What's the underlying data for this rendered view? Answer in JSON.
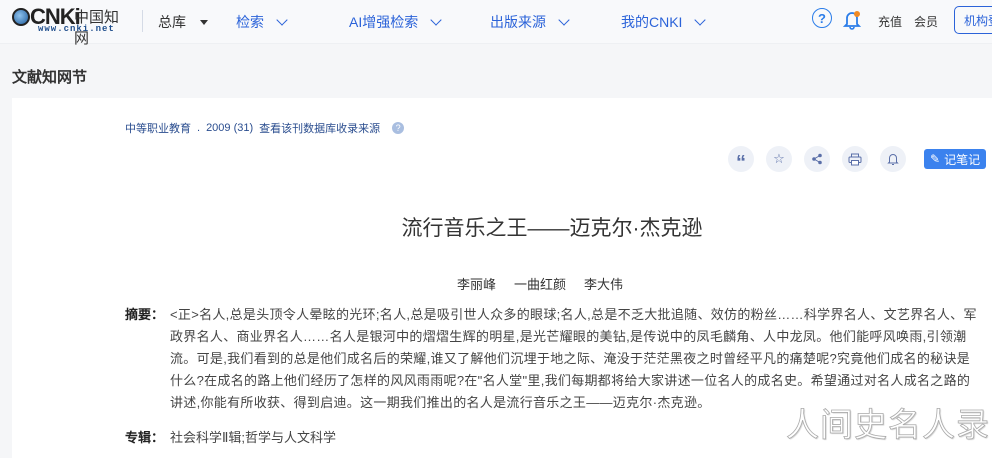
{
  "header": {
    "logo_big": "CNKi",
    "logo_cn": "中国知网",
    "logo_url": "www.cnki.net",
    "nav": [
      {
        "label": "总库"
      },
      {
        "label": "检索"
      },
      {
        "label": "AI增强检索"
      },
      {
        "label": "出版来源"
      },
      {
        "label": "我的CNKI"
      }
    ],
    "help": "?",
    "recharge": "充值",
    "member": "会员",
    "org": "机构登录"
  },
  "section_title": "文献知网节",
  "source": {
    "journal": "中等职业教育",
    "sep": ".",
    "issue": "2009 (31)",
    "link": "查看该刊数据库收录来源",
    "help": "?"
  },
  "tools": {
    "cite": "“",
    "favorite": "☆",
    "share": "<",
    "print": "⎙",
    "alert": "🔔",
    "note_label": "记笔记"
  },
  "article": {
    "title": "流行音乐之王——迈克尔·杰克逊",
    "authors": [
      "李丽峰",
      "一曲红颜",
      "李大伟"
    ],
    "abstract_label": "摘要：",
    "abstract": "<正>名人,总是头顶令人晕眩的光环;名人,总是吸引世人众多的眼球;名人,总是不乏大批追随、效仿的粉丝……科学界名人、文艺界名人、军政界名人、商业界名人……名人是银河中的熠熠生辉的明星,是光芒耀眼的美钻,是传说中的凤毛麟角、人中龙凤。他们能呼风唤雨,引领潮流。可是,我们看到的总是他们成名后的荣耀,谁又了解他们沉埋于地之际、淹没于茫茫黑夜之时曾经平凡的痛楚呢?究竟他们成名的秘诀是什么?在成名的路上他们经历了怎样的风风雨雨呢?在\"名人堂\"里,我们每期都将给大家讲述一位名人的成名史。希望通过对名人成名之路的讲述,你能有所收获、得到启迪。这一期我们推出的名人是流行音乐之王——迈克尔·杰克逊。",
    "album_label": "专辑：",
    "album": "社会科学Ⅱ辑;哲学与人文科学"
  },
  "watermark": "人间史名人录"
}
